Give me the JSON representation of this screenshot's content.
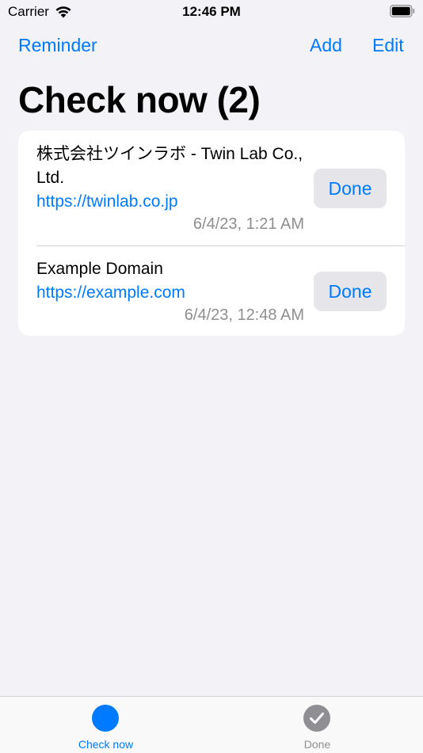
{
  "status_bar": {
    "carrier": "Carrier",
    "time": "12:46 PM",
    "wifi_icon": "wifi-icon",
    "battery_icon": "battery-icon"
  },
  "nav": {
    "back_label": "Reminder",
    "add_label": "Add",
    "edit_label": "Edit"
  },
  "page": {
    "title": "Check now (2)"
  },
  "items": [
    {
      "title": "株式会社ツインラボ - Twin Lab Co., Ltd.",
      "url": "https://twinlab.co.jp",
      "date": "6/4/23, 1:21 AM",
      "done_label": "Done"
    },
    {
      "title": "Example Domain",
      "url": "https://example.com",
      "date": "6/4/23, 12:48 AM",
      "done_label": "Done"
    }
  ],
  "tab_bar": {
    "tabs": [
      {
        "label": "Check now",
        "icon": "filled-circle-icon",
        "selected": true
      },
      {
        "label": "Done",
        "icon": "checkmark-circle-icon",
        "selected": false
      }
    ]
  },
  "colors": {
    "accent": "#007aff",
    "background": "#f2f2f7",
    "secondary_text": "#8e8e93",
    "button_fill": "#e5e5ea"
  }
}
